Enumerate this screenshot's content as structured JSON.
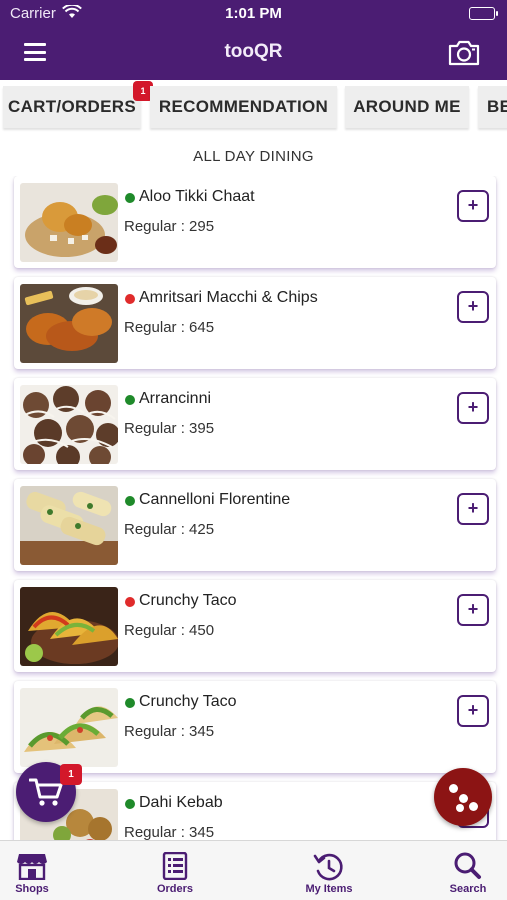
{
  "status": {
    "carrier": "Carrier",
    "time": "1:01 PM"
  },
  "header": {
    "title": "tooQR",
    "menu_icon": "hamburger-icon",
    "camera_icon": "camera-icon"
  },
  "tabs": [
    {
      "label": "CART/ORDERS",
      "badge": "1"
    },
    {
      "label": "RECOMMENDATION"
    },
    {
      "label": "AROUND ME"
    },
    {
      "label": "BE"
    }
  ],
  "section_title": "ALL DAY DINING",
  "colors": {
    "brand": "#4b1d73",
    "veg": "#1f8a2a",
    "nonveg": "#e02b2b",
    "badge": "#d3182a",
    "fab_dice": "#8c1414"
  },
  "items": [
    {
      "name": "Aloo Tikki Chaat",
      "price": "Regular : 295",
      "type": "veg",
      "add": "+"
    },
    {
      "name": "Amritsari Macchi & Chips",
      "price": "Regular : 645",
      "type": "nonveg",
      "add": "+"
    },
    {
      "name": "Arrancinni",
      "price": "Regular : 395",
      "type": "veg",
      "add": "+"
    },
    {
      "name": "Cannelloni Florentine",
      "price": "Regular : 425",
      "type": "veg",
      "add": "+"
    },
    {
      "name": "Crunchy Taco",
      "price": "Regular : 450",
      "type": "nonveg",
      "add": "+"
    },
    {
      "name": "Crunchy Taco",
      "price": "Regular : 345",
      "type": "veg",
      "add": "+"
    },
    {
      "name": "Dahi Kebab",
      "price": "Regular : 345",
      "type": "veg",
      "add": "+"
    }
  ],
  "cart_fab": {
    "badge": "1",
    "icon": "shopping-cart-icon"
  },
  "dice_fab": {
    "icon": "dice-icon"
  },
  "bottom_nav": [
    {
      "label": "Shops",
      "icon": "store-icon"
    },
    {
      "label": "Orders",
      "icon": "receipt-list-icon"
    },
    {
      "label": "My Items",
      "icon": "history-clock-icon"
    },
    {
      "label": "Search",
      "icon": "search-icon"
    }
  ]
}
